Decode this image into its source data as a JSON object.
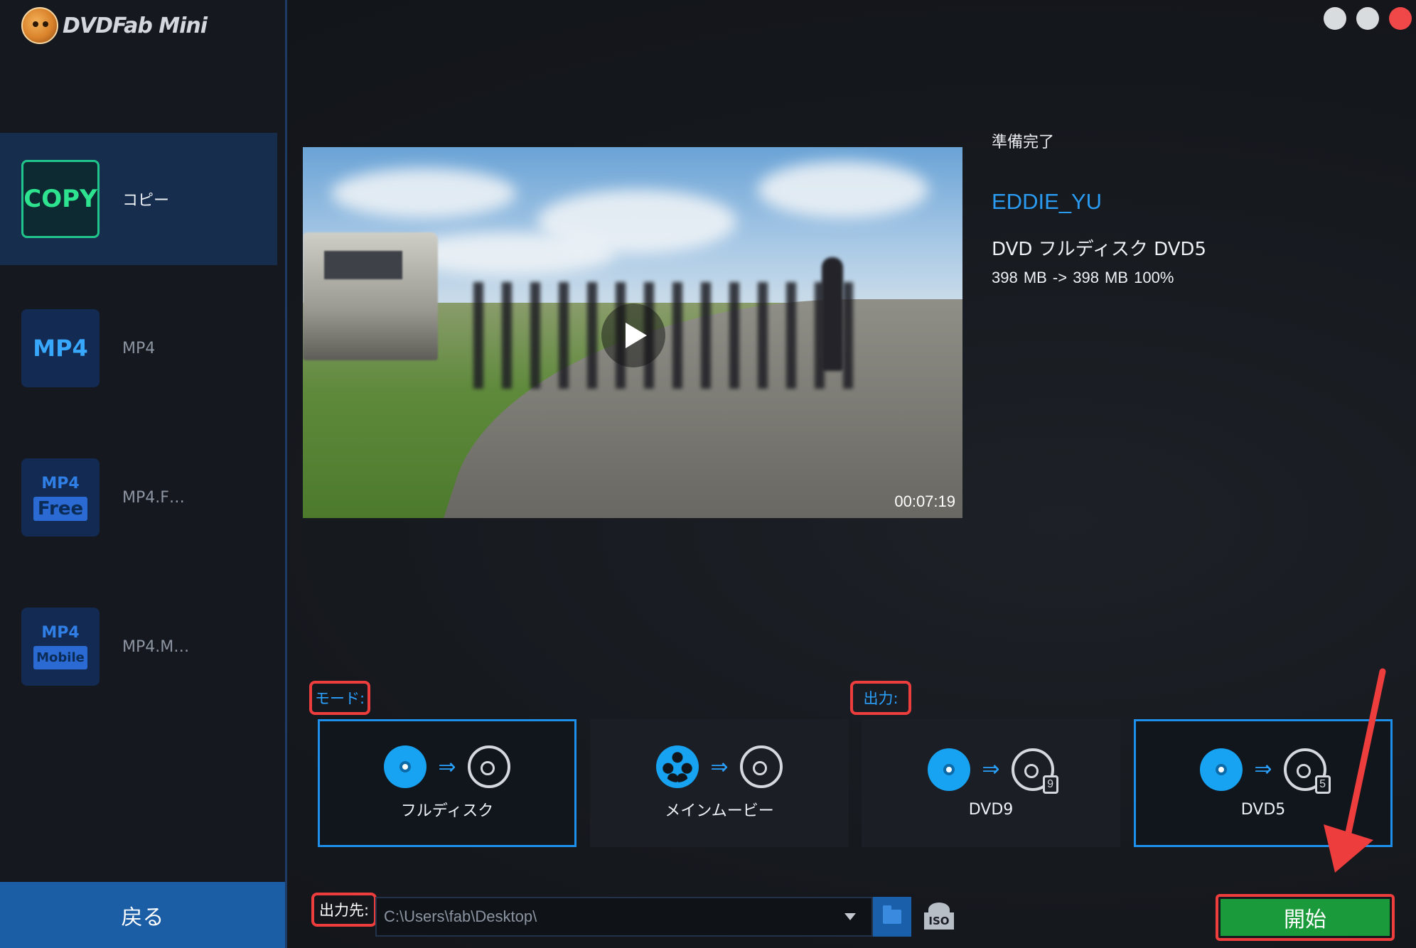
{
  "app": {
    "logo_text": "DVDFab Mini"
  },
  "window_controls": [
    "minimize",
    "maximize",
    "close"
  ],
  "sidebar": {
    "items": [
      {
        "icon_text": "COPY",
        "label": "コピー",
        "active": true
      },
      {
        "icon_text": "MP4",
        "label": "MP4",
        "active": false
      },
      {
        "icon_top": "MP4",
        "icon_bottom": "Free",
        "label": "MP4.F…",
        "active": false
      },
      {
        "icon_top": "MP4",
        "icon_bottom": "Mobile",
        "label": "MP4.M…",
        "active": false
      }
    ],
    "back_label": "戻る"
  },
  "video": {
    "duration": "00:07:19"
  },
  "info": {
    "status": "準備完了",
    "title": "EDDIE_YU",
    "format": "DVD フルディスク DVD5",
    "size": "398 MB -> 398 MB  100%"
  },
  "mode": {
    "label": "モード:",
    "options": [
      {
        "label": "フルディスク",
        "selected": true
      },
      {
        "label": "メインムービー",
        "selected": false
      }
    ]
  },
  "output": {
    "label": "出力:",
    "options": [
      {
        "label": "DVD9",
        "badge": "9",
        "selected": false
      },
      {
        "label": "DVD5",
        "badge": "5",
        "selected": true
      }
    ]
  },
  "destination": {
    "label": "出力先:",
    "path": "C:\\Users\\fab\\Desktop\\",
    "iso_label": "ISO"
  },
  "start_label": "開始",
  "colors": {
    "accent_blue": "#1e8fea",
    "start_green": "#1a9a3a",
    "highlight_red": "#ee3d3d",
    "copy_green": "#2ee38f"
  }
}
